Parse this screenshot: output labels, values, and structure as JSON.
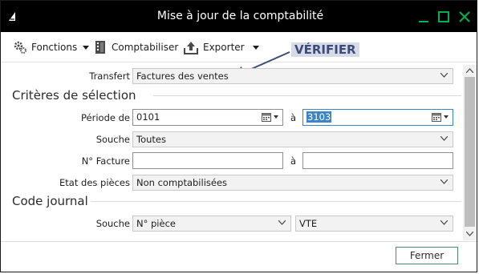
{
  "window": {
    "title": "Mise à jour de la comptabilité"
  },
  "toolbar": {
    "fonctions": "Fonctions",
    "comptabiliser": "Comptabiliser",
    "exporter": "Exporter"
  },
  "annotation": "VÉRIFIER",
  "transfert": {
    "label": "Transfert",
    "value": "Factures des ventes"
  },
  "criteres": {
    "title": "Critères de sélection",
    "periode_label": "Période de",
    "periode_from": "0101",
    "a_label": "à",
    "periode_to": "3103",
    "souche_label": "Souche",
    "souche_value": "Toutes",
    "facture_label": "N° Facture",
    "facture_from": "",
    "facture_to": "",
    "etat_label": "Etat des pièces",
    "etat_value": "Non comptabilisées"
  },
  "journal": {
    "title": "Code journal",
    "souche_label": "Souche",
    "souche_value": "N° pièce",
    "code_value": "VTE"
  },
  "footer": {
    "close": "Fermer"
  },
  "colors": {
    "titlebar": "#000000",
    "accent": "#00b050",
    "selection": "#3a84c8",
    "annotation": "#3e4a78"
  }
}
